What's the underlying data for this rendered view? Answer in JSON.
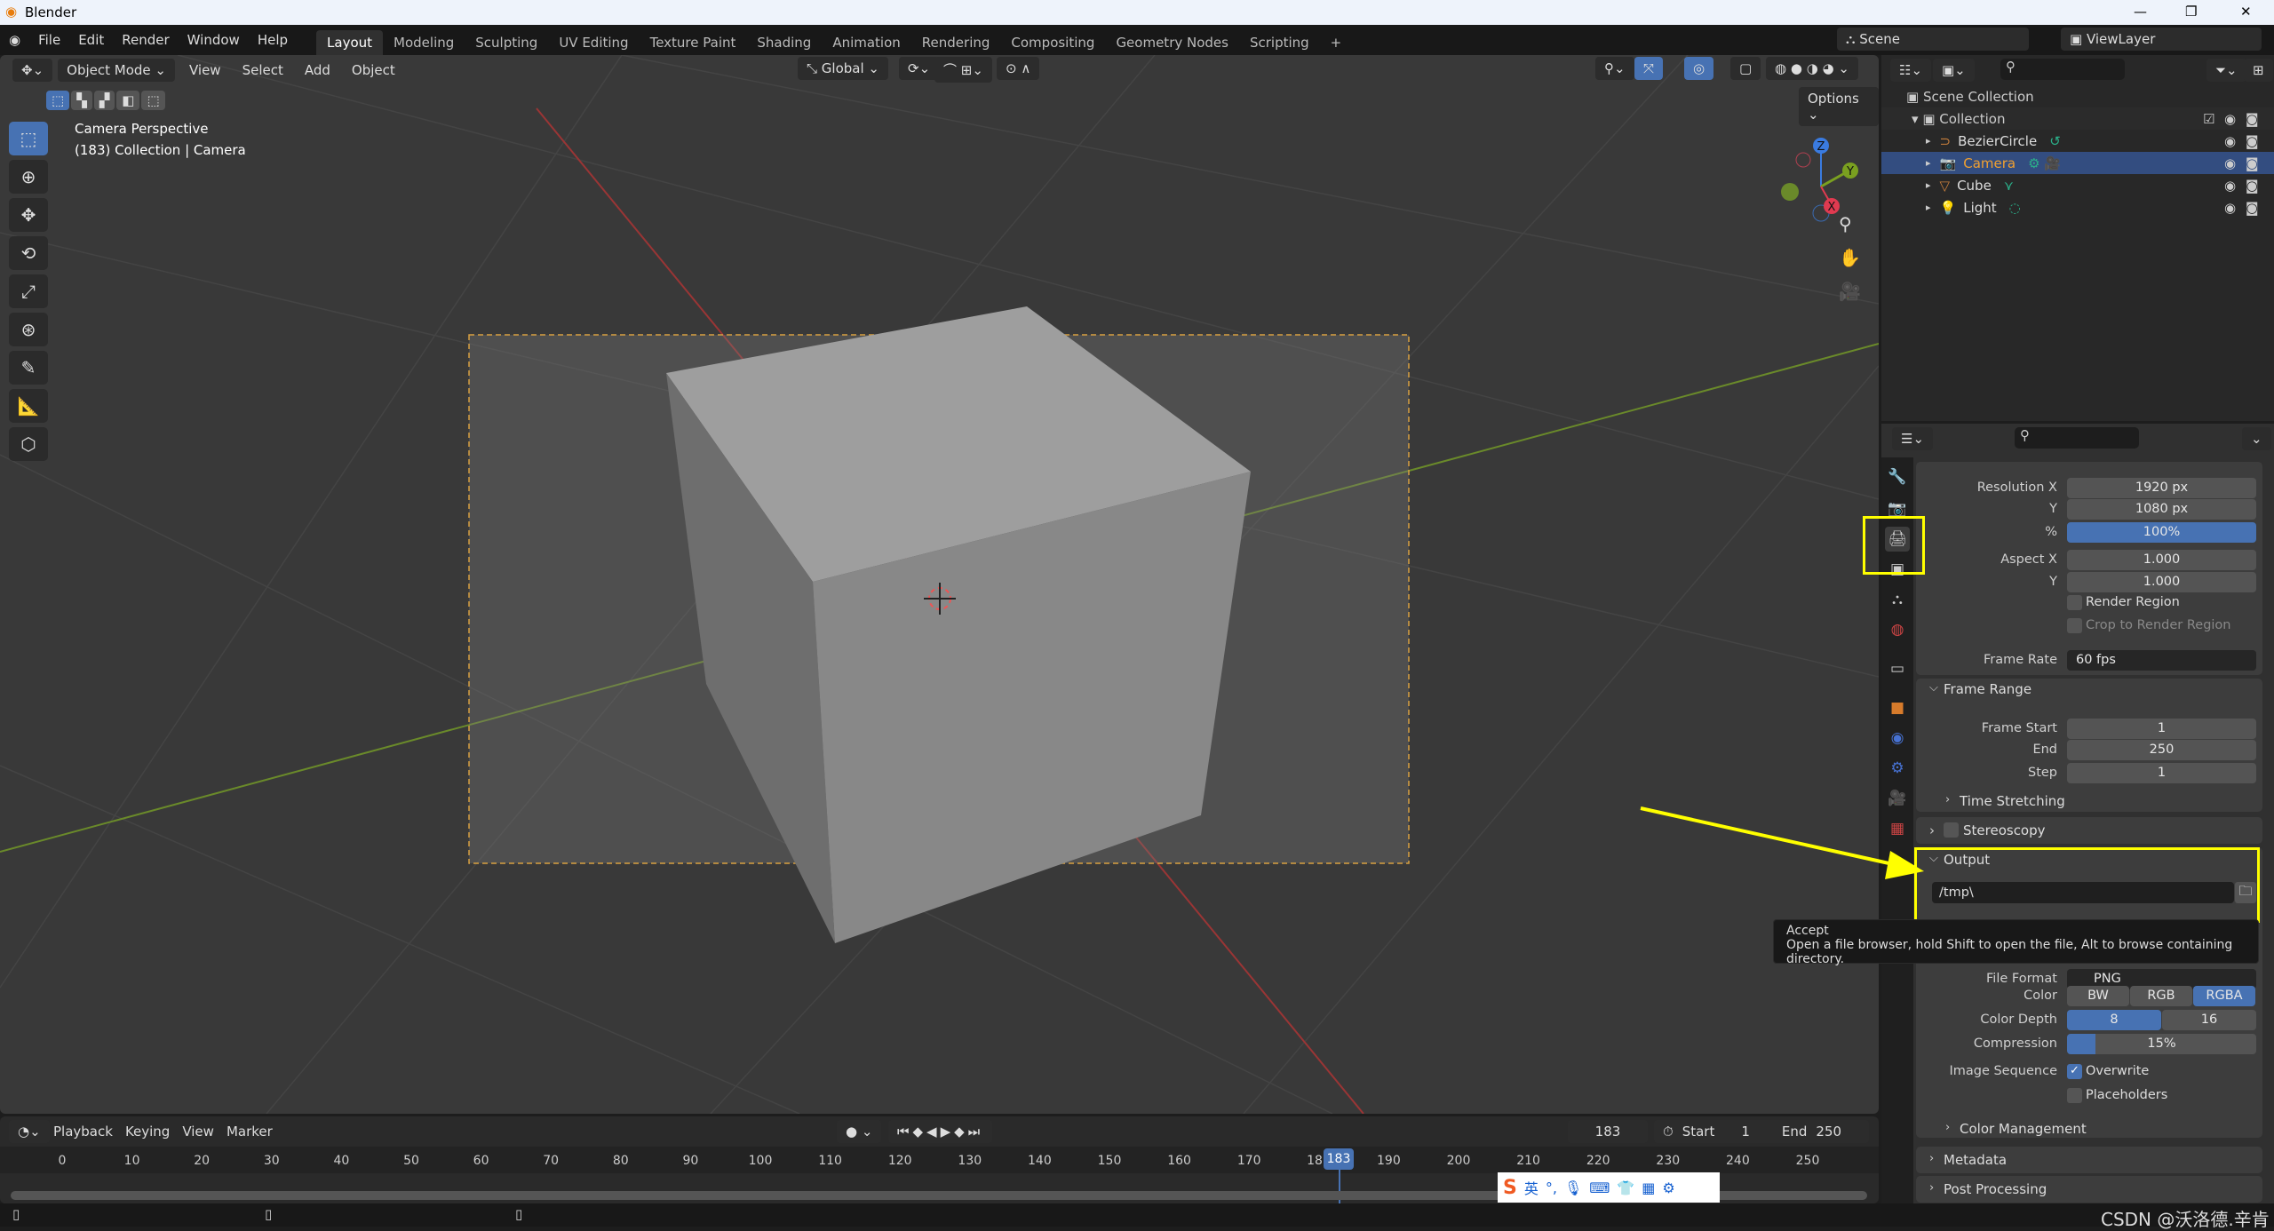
{
  "app": {
    "title": "Blender",
    "window_controls": [
      "—",
      "❐",
      "✕"
    ]
  },
  "menu": {
    "items": [
      "File",
      "Edit",
      "Render",
      "Window",
      "Help"
    ],
    "workspaces": [
      "Layout",
      "Modeling",
      "Sculpting",
      "UV Editing",
      "Texture Paint",
      "Shading",
      "Animation",
      "Rendering",
      "Compositing",
      "Geometry Nodes",
      "Scripting",
      "+"
    ],
    "active_workspace": "Layout",
    "scene": "Scene",
    "view_layer": "ViewLayer"
  },
  "viewport": {
    "mode": "Object Mode",
    "menus": [
      "View",
      "Select",
      "Add",
      "Object"
    ],
    "orientation": "Global",
    "options_label": "Options",
    "overlay_title": "Camera Perspective",
    "overlay_subtitle": "(183) Collection | Camera",
    "gizmo_axes": [
      "Z",
      "Y",
      "X"
    ]
  },
  "outliner": {
    "root": "Scene Collection",
    "collection": "Collection",
    "items": [
      {
        "name": "BezierCircle",
        "color": "#c87f3c"
      },
      {
        "name": "Camera",
        "color": "#f0a030",
        "selected": true
      },
      {
        "name": "Cube",
        "color": "#c87f3c"
      },
      {
        "name": "Light",
        "color": "#c87f3c"
      }
    ]
  },
  "properties": {
    "format_rows": [
      {
        "label": "Resolution X",
        "value": "1920 px"
      },
      {
        "label": "Y",
        "value": "1080 px"
      },
      {
        "label": "%",
        "value": "100%",
        "highlight": true
      },
      {
        "label": "Aspect X",
        "value": "1.000"
      },
      {
        "label": "Y",
        "value": "1.000"
      }
    ],
    "render_region": "Render Region",
    "crop_region": "Crop to Render Region",
    "frame_rate_label": "Frame Rate",
    "frame_rate": "60 fps",
    "frame_range": {
      "title": "Frame Range",
      "rows": [
        {
          "label": "Frame Start",
          "value": "1"
        },
        {
          "label": "End",
          "value": "250"
        },
        {
          "label": "Step",
          "value": "1"
        }
      ],
      "time_stretching": "Time Stretching"
    },
    "stereoscopy": "Stereoscopy",
    "output": {
      "title": "Output",
      "path": "/tmp\\",
      "file_format_label": "File Format",
      "file_format": "PNG",
      "color_label": "Color",
      "color_options": [
        "BW",
        "RGB",
        "RGBA"
      ],
      "color_selected": "RGBA",
      "depth_label": "Color Depth",
      "depth_options": [
        "8",
        "16"
      ],
      "depth_selected": "8",
      "compression_label": "Compression",
      "compression": "15%",
      "compression_value": 15,
      "image_sequence_label": "Image Sequence",
      "overwrite": "Overwrite",
      "overwrite_checked": true,
      "placeholders": "Placeholders",
      "color_management": "Color Management"
    },
    "metadata": "Metadata",
    "post_processing": "Post Processing"
  },
  "tooltip": {
    "title": "Accept",
    "body": "Open a file browser, hold Shift to open the file, Alt to browse containing directory."
  },
  "timeline": {
    "menus": [
      "Playback",
      "Keying",
      "View",
      "Marker"
    ],
    "current_frame": "183",
    "start_label": "Start",
    "start": "1",
    "end_label": "End",
    "end": "250",
    "ticks": [
      "0",
      "10",
      "20",
      "30",
      "40",
      "50",
      "60",
      "70",
      "80",
      "90",
      "100",
      "110",
      "120",
      "130",
      "140",
      "150",
      "160",
      "170",
      "180",
      "190",
      "200",
      "210",
      "220",
      "230",
      "240",
      "250"
    ]
  },
  "ime": {
    "label": "英"
  },
  "watermark": "CSDN @沃洛德.辛肯",
  "annotation_color": "#ffff00"
}
